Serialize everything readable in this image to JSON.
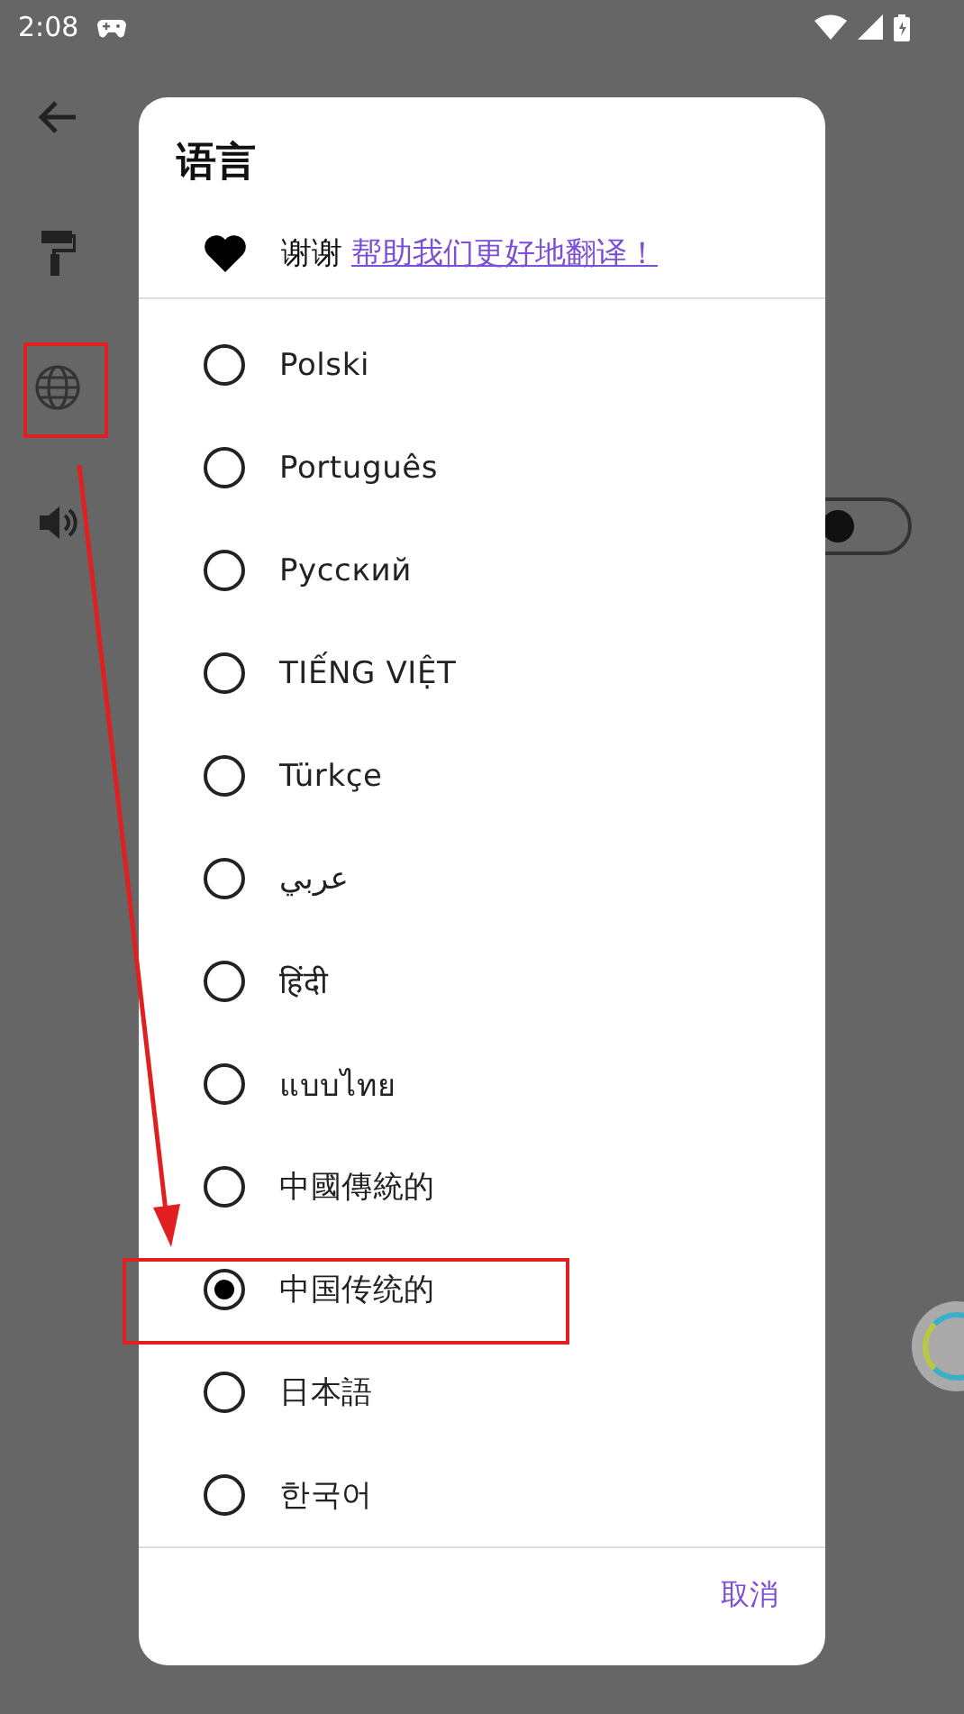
{
  "status_bar": {
    "time": "2:08"
  },
  "settings": {
    "switch": {
      "on": false
    }
  },
  "dialog": {
    "title": "语言",
    "thanks": {
      "text": "谢谢",
      "link": "帮助我们更好地翻译！"
    },
    "options": [
      {
        "label": "Polski",
        "selected": false
      },
      {
        "label": "Português",
        "selected": false
      },
      {
        "label": "Русский",
        "selected": false
      },
      {
        "label": "TIẾNG VIỆT",
        "selected": false
      },
      {
        "label": "Türkçe",
        "selected": false
      },
      {
        "label": "عربي",
        "selected": false
      },
      {
        "label": "हिंदी",
        "selected": false
      },
      {
        "label": "แบบไทย",
        "selected": false
      },
      {
        "label": "中國傳統的",
        "selected": false
      },
      {
        "label": "中国传统的",
        "selected": true
      },
      {
        "label": "日本語",
        "selected": false
      },
      {
        "label": "한국어",
        "selected": false
      }
    ],
    "buttons": [
      "取消"
    ]
  }
}
